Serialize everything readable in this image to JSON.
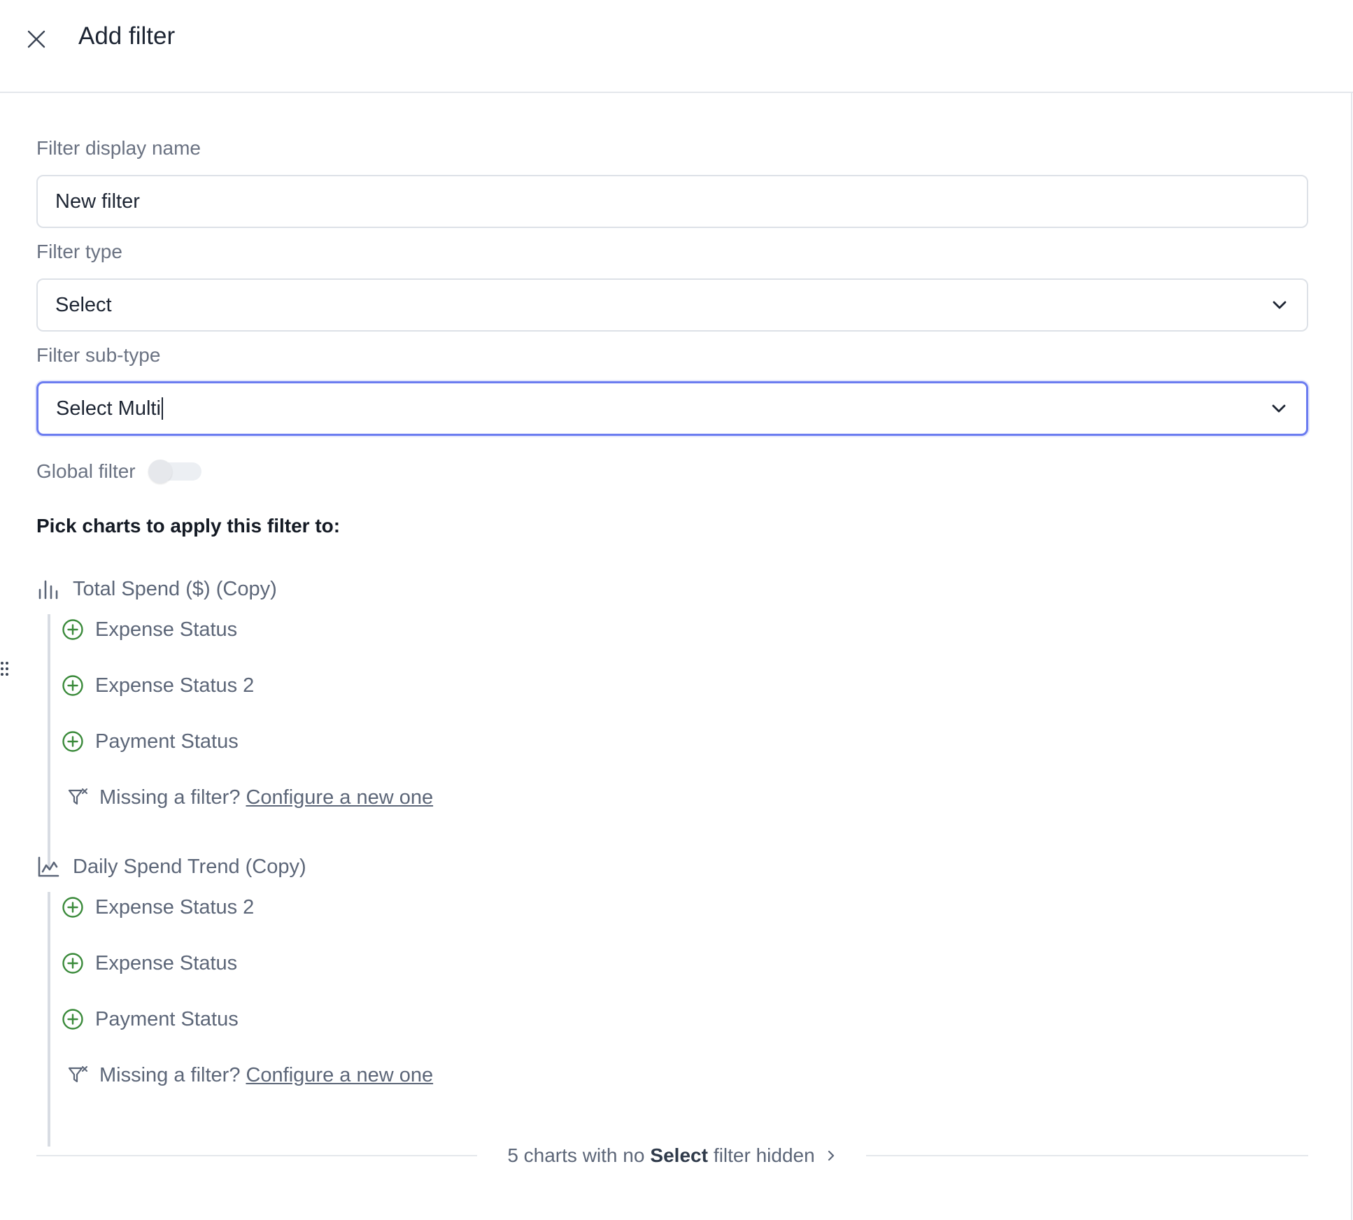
{
  "header": {
    "title": "Add filter"
  },
  "form": {
    "display_name_label": "Filter display name",
    "display_name_value": "New filter",
    "type_label": "Filter type",
    "type_value": "Select",
    "subtype_label": "Filter sub-type",
    "subtype_value": "Select Multi",
    "global_label": "Global filter",
    "global_enabled": false
  },
  "section": {
    "heading": "Pick charts to apply this filter to:"
  },
  "charts": [
    {
      "title": "Total Spend ($) (Copy)",
      "icon": "bar-chart-icon",
      "filters": [
        "Expense Status",
        "Expense Status 2",
        "Payment Status"
      ],
      "missing_text": "Missing a filter?",
      "missing_link": "Configure a new one"
    },
    {
      "title": "Daily Spend Trend (Copy)",
      "icon": "line-chart-icon",
      "filters": [
        "Expense Status 2",
        "Expense Status",
        "Payment Status"
      ],
      "missing_text": "Missing a filter?",
      "missing_link": "Configure a new one"
    }
  ],
  "footer": {
    "prefix": "5 charts with no",
    "bold": "Select",
    "suffix": "filter hidden"
  },
  "colors": {
    "accent_focus": "#6b7cf0",
    "add_icon": "#3a8a3a",
    "text_muted": "#5c6678"
  }
}
